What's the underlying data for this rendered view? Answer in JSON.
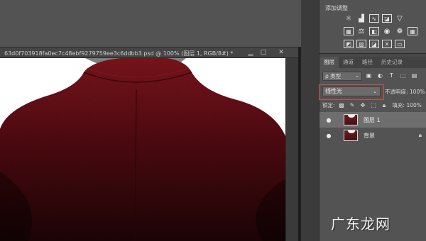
{
  "document": {
    "title": "63d0f703918fa0ec7c48ebf9279759ee3c6ddbb3.psd @ 100% (图层 1, RGB/8#) *",
    "window_controls": {
      "minimize": "▁",
      "maximize": "□",
      "close": "✕"
    }
  },
  "adjustments": {
    "title": "添加调整",
    "row1": [
      "brightness-icon",
      "levels-icon",
      "curves-icon",
      "exposure-icon",
      "gradient-ramp-icon"
    ],
    "row2": [
      "vibrance-icon",
      "balance-icon",
      "bw-icon",
      "photo-filter-icon",
      "channel-mixer-icon",
      "color-lookup-icon"
    ],
    "row3": [
      "invert-icon",
      "posterize-icon",
      "threshold-icon",
      "selective-color-icon",
      "gradient-map-icon"
    ]
  },
  "layers_panel": {
    "tabs": [
      "图层",
      "通道",
      "路径",
      "历史记录"
    ],
    "active_tab": 0,
    "filter": {
      "label": "ρ 类型",
      "caret": "⌄"
    },
    "blend_mode": {
      "value": "线性光",
      "caret": "⌄"
    },
    "opacity_label": "不透明度: 100%",
    "lock_label": "锁定:",
    "fill_label": "填充: 100%",
    "layers": [
      {
        "name": "图层 1",
        "visible": true,
        "selected": true
      },
      {
        "name": "背景",
        "visible": true,
        "selected": false,
        "locked": true
      }
    ]
  },
  "watermark": "广东龙网",
  "colors": {
    "suit": "#5a0c12",
    "highlight_border": "#c8504a",
    "panel_bg": "#535353"
  }
}
